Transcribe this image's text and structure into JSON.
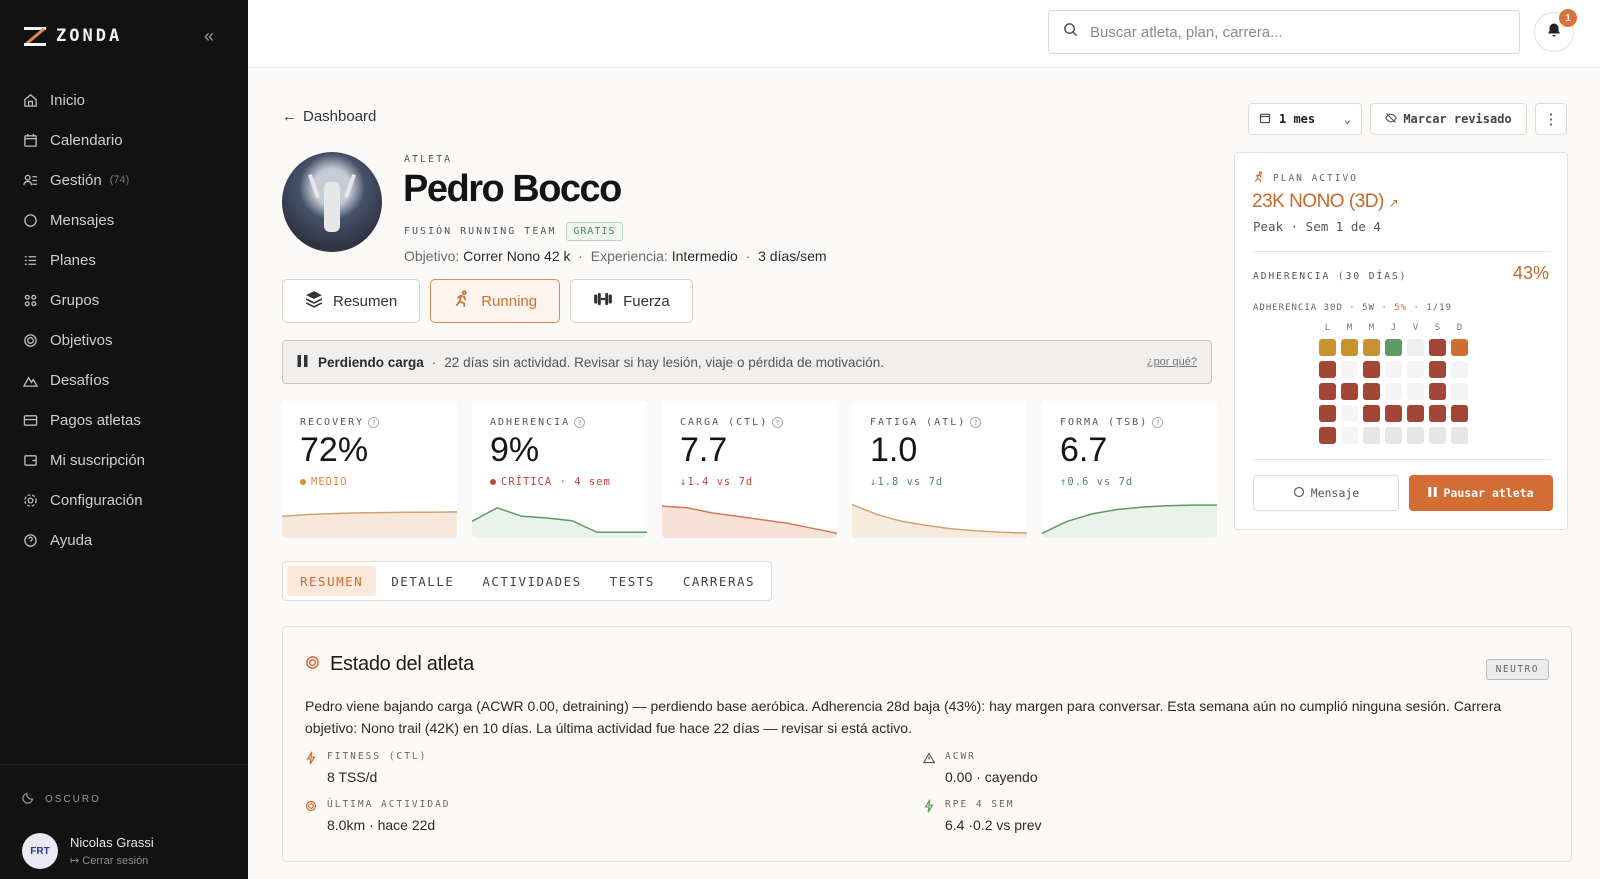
{
  "brand": {
    "name": "ZONDA"
  },
  "nav": [
    {
      "label": "Inicio",
      "icon": "home-icon"
    },
    {
      "label": "Calendario",
      "icon": "calendar-icon"
    },
    {
      "label": "Gestión",
      "icon": "users-list-icon",
      "count": "(74)"
    },
    {
      "label": "Mensajes",
      "icon": "chat-icon"
    },
    {
      "label": "Planes",
      "icon": "list-icon"
    },
    {
      "label": "Grupos",
      "icon": "group-icon"
    },
    {
      "label": "Objetivos",
      "icon": "target-icon"
    },
    {
      "label": "Desafíos",
      "icon": "mountain-icon"
    },
    {
      "label": "Pagos atletas",
      "icon": "card-icon"
    },
    {
      "label": "Mi suscripción",
      "icon": "wallet-icon"
    },
    {
      "label": "Configuración",
      "icon": "gear-icon"
    },
    {
      "label": "Ayuda",
      "icon": "help-icon"
    }
  ],
  "sidebar_bottom": {
    "theme_label": "OSCURO",
    "user_name": "Nicolas Grassi",
    "logout_label": "Cerrar sesión",
    "avatar_text": "FRT"
  },
  "topbar": {
    "search_placeholder": "Buscar atleta, plan, carrera...",
    "notifications_count": "1"
  },
  "header": {
    "back_label": "Dashboard",
    "period": "1 mes",
    "mark_reviewed": "Marcar revisado"
  },
  "athlete": {
    "label": "ATLETA",
    "name": "Pedro Bocco",
    "team": "FUSIÓN RUNNING TEAM",
    "tier": "GRATIS",
    "goal_label": "Objetivo:",
    "goal": "Correr Nono 42 k",
    "experience_label": "Experiencia:",
    "experience": "Intermedio",
    "frequency": "3 días/sem"
  },
  "sport_tabs": [
    {
      "label": "Resumen",
      "icon": "layers-icon"
    },
    {
      "label": "Running",
      "icon": "runner-icon",
      "active": true
    },
    {
      "label": "Fuerza",
      "icon": "dumbbell-icon"
    }
  ],
  "alert": {
    "title": "Perdiendo carga",
    "message": "22 días sin actividad. Revisar si hay lesión, viaje o pérdida de motivación.",
    "why": "¿por qué?"
  },
  "metrics": [
    {
      "label": "RECOVERY",
      "value": "72%",
      "sub": "MEDIO",
      "sub_color": "#d98a3a",
      "line_color": "#d4a26f",
      "fill_color": "#f6e8da",
      "trend": [
        0.55,
        0.6,
        0.63,
        0.65,
        0.66,
        0.67,
        0.67,
        0.68
      ]
    },
    {
      "label": "ADHERENCIA",
      "value": "9%",
      "sub": "CRÍTICA · 4 sem",
      "sub_color": "#c0463a",
      "line_color": "#5c9a63",
      "fill_color": "#eaf3eb",
      "trend": [
        0.4,
        0.8,
        0.55,
        0.5,
        0.42,
        0.08,
        0.08,
        0.08
      ]
    },
    {
      "label": "CARGA (CTL)",
      "value": "7.7",
      "sub": "↓1.4 vs 7d",
      "sub_color": "#c0463a",
      "line_color": "#d27a57",
      "fill_color": "#f8e1d6",
      "trend": [
        0.85,
        0.8,
        0.65,
        0.55,
        0.45,
        0.35,
        0.2,
        0.05
      ]
    },
    {
      "label": "FATIGA (ATL)",
      "value": "1.0",
      "sub": "↓1.8 vs 7d",
      "sub_color": "#4f8a58",
      "line_color": "#d4a26f",
      "fill_color": "#f6ebdf",
      "trend": [
        0.9,
        0.6,
        0.4,
        0.28,
        0.18,
        0.12,
        0.08,
        0.06
      ]
    },
    {
      "label": "FORMA (TSB)",
      "value": "6.7",
      "sub": "↑0.6 vs 7d",
      "sub_color": "#4f8a58",
      "line_color": "#5c9a63",
      "fill_color": "#eaf3eb",
      "trend": [
        0.05,
        0.4,
        0.62,
        0.75,
        0.82,
        0.86,
        0.88,
        0.88
      ]
    }
  ],
  "plan": {
    "label": "PLAN ACTIVO",
    "name": "23K NONO (3D)",
    "meta": "Peak · Sem 1 de 4",
    "adherence_label": "ADHERENCIA (30 DÍAS)",
    "adherence_value": "43%",
    "legend_prefix": "ADHERENCIA 30D · 5W · ",
    "legend_hot": "5%",
    "legend_suffix": " · 1/19",
    "days": [
      "L",
      "M",
      "M",
      "J",
      "V",
      "S",
      "D"
    ],
    "heatmap": [
      [
        "#c7922f",
        "#c7922f",
        "#c7922f",
        "#5e9a62",
        "#efefef",
        "#a24638",
        "#d06d33"
      ],
      [
        "#a24638",
        "#f5f5f5",
        "#a24638",
        "#f5f5f5",
        "#f5f5f5",
        "#a24638",
        "#f5f5f5"
      ],
      [
        "#a24638",
        "#a24638",
        "#a24638",
        "#f5f5f5",
        "#f5f5f5",
        "#a24638",
        "#f5f5f5"
      ],
      [
        "#a24638",
        "#f5f5f5",
        "#a24638",
        "#a24638",
        "#a24638",
        "#a24638",
        "#a24638"
      ],
      [
        "#a24638",
        "#f5f5f5",
        "#e6e6e6",
        "#e6e6e6",
        "#e6e6e6",
        "#e6e6e6",
        "#e6e6e6"
      ]
    ],
    "message_btn": "Mensaje",
    "pause_btn": "Pausar atleta"
  },
  "section_tabs": [
    {
      "label": "RESUMEN",
      "active": true
    },
    {
      "label": "DETALLE"
    },
    {
      "label": "ACTIVIDADES"
    },
    {
      "label": "TESTS"
    },
    {
      "label": "CARRERAS"
    }
  ],
  "state": {
    "title": "Estado del atleta",
    "badge": "NEUTRO",
    "text": "Pedro viene bajando carga (ACWR 0.00, detraining) — perdiendo base aeróbica. Adherencia 28d baja (43%): hay margen para conversar. Esta semana aún no cumplió ninguna sesión. Carrera objetivo: Nono trail (42K) en 10 días. La última actividad fue hace 22 días — revisar si está activo.",
    "items": [
      {
        "key": "FITNESS (CTL)",
        "value": "8 TSS/d",
        "icon": "bolt-icon"
      },
      {
        "key": "ACWR",
        "value": "0.00 · cayendo",
        "icon": "warning-icon"
      },
      {
        "key": "ÚLTIMA ACTIVIDAD",
        "value": "8.0km · hace 22d",
        "icon": "target-icon"
      },
      {
        "key": "RPE 4 SEM",
        "value": "6.4 ·0.2 vs prev",
        "icon": "bolt-icon"
      }
    ]
  }
}
